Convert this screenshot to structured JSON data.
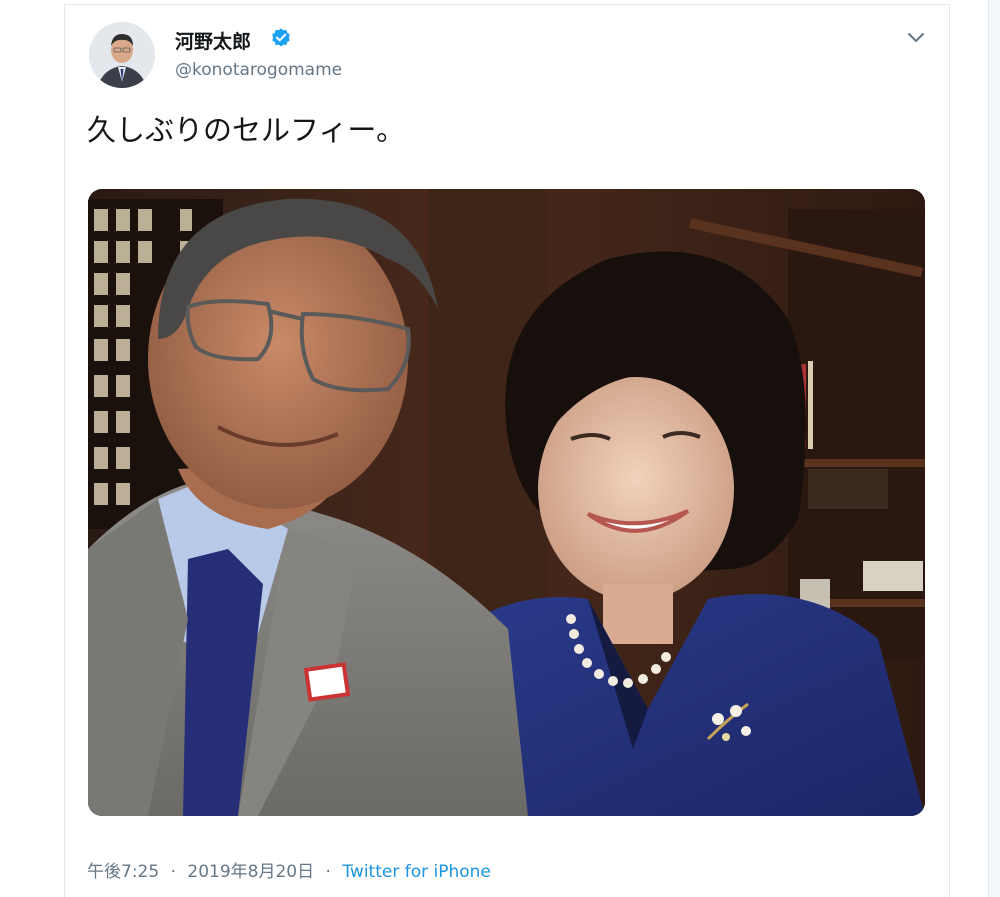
{
  "tweet": {
    "display_name": "河野太郎",
    "username": "@konotarogomame",
    "verified": true,
    "text": "久しぶりのセルフィー。",
    "time": "午後7:25",
    "separator": "·",
    "date": "2019年8月20日",
    "source": "Twitter for iPhone"
  },
  "icons": {
    "verified": "verified-badge-icon",
    "menu": "chevron-down-icon"
  },
  "colors": {
    "verified_blue": "#1da1f2",
    "link_blue": "#1b95e0",
    "secondary_text": "#657786",
    "primary_text": "#14171a"
  }
}
